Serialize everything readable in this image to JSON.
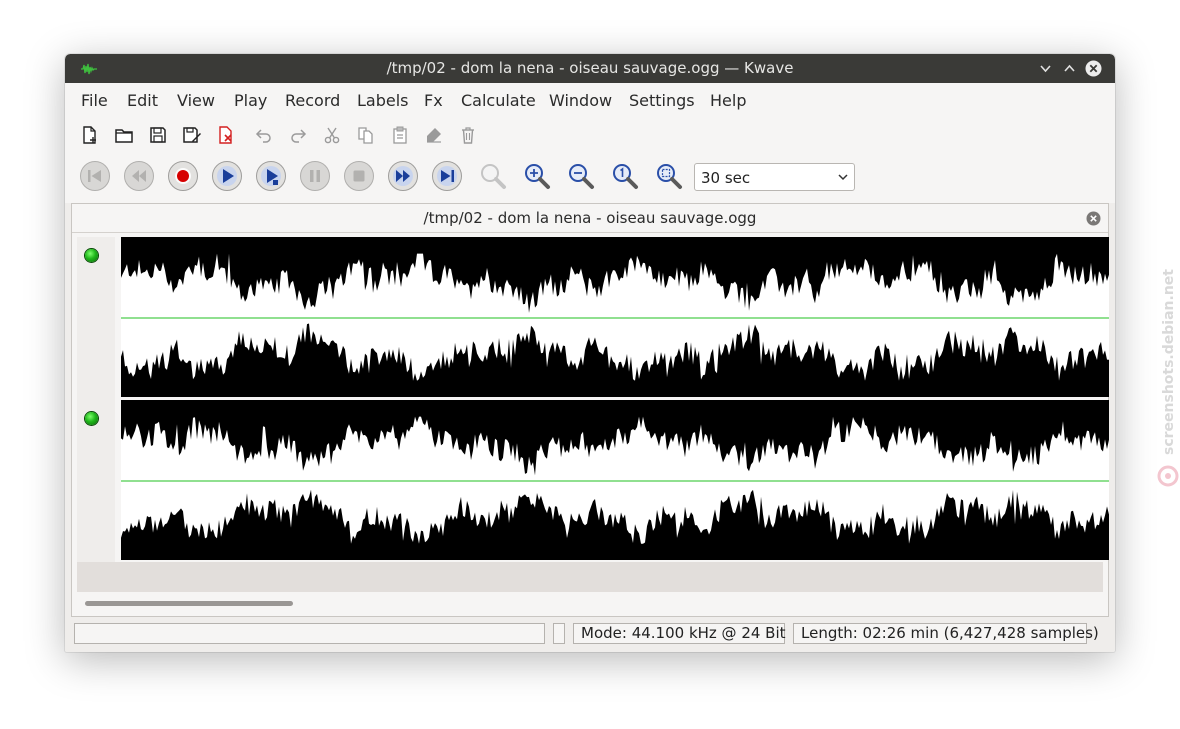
{
  "window": {
    "title": "/tmp/02 - dom la nena - oiseau sauvage.ogg — Kwave",
    "controls": [
      "minimize",
      "maximize",
      "close"
    ]
  },
  "menubar": [
    "File",
    "Edit",
    "View",
    "Play",
    "Record",
    "Labels",
    "Fx",
    "Calculate",
    "Window",
    "Settings",
    "Help"
  ],
  "toolbar_file": [
    {
      "icon": "new-file-icon"
    },
    {
      "icon": "open-folder-icon"
    },
    {
      "icon": "save-icon"
    },
    {
      "icon": "save-as-icon"
    },
    {
      "icon": "close-file-icon"
    },
    {
      "icon": "undo-icon"
    },
    {
      "icon": "redo-icon"
    },
    {
      "icon": "cut-icon"
    },
    {
      "icon": "copy-icon"
    },
    {
      "icon": "paste-icon"
    },
    {
      "icon": "erase-icon"
    },
    {
      "icon": "delete-icon"
    }
  ],
  "toolbar_playback": [
    {
      "icon": "skip-to-start-icon"
    },
    {
      "icon": "rewind-icon"
    },
    {
      "icon": "record-icon"
    },
    {
      "icon": "play-icon"
    },
    {
      "icon": "loop-play-icon"
    },
    {
      "icon": "pause-icon"
    },
    {
      "icon": "stop-icon"
    },
    {
      "icon": "fast-forward-icon"
    },
    {
      "icon": "skip-to-end-icon"
    },
    {
      "icon": "zoom-selection-icon"
    },
    {
      "icon": "zoom-in-icon"
    },
    {
      "icon": "zoom-out-icon"
    },
    {
      "icon": "zoom-original-icon"
    },
    {
      "icon": "zoom-fit-icon"
    }
  ],
  "zoom": {
    "value": "30 sec"
  },
  "document": {
    "title": "/tmp/02 - dom la nena - oiseau sauvage.ogg"
  },
  "tracks": [
    {
      "channel": 1,
      "selected": true
    },
    {
      "channel": 2,
      "selected": true
    }
  ],
  "statusbar": {
    "message": "",
    "mode": "Mode: 44.100 kHz @ 24 Bit",
    "length": "Length: 02:26 min (6,427,428 samples)"
  },
  "watermark": {
    "text": "screenshots.debian.net"
  },
  "colors": {
    "titlebar": "#3a3a37",
    "waveform_bg": "#000000",
    "waveform_fg": "#ffffff",
    "zero_line": "#22c022",
    "led": "#1fb61a",
    "record": "#d60000",
    "play_blue": "#1a3e9a"
  }
}
